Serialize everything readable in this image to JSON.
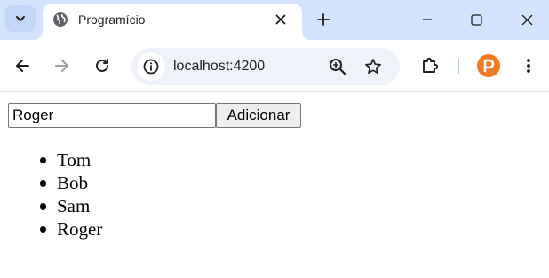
{
  "browser": {
    "tab": {
      "title": "Programício"
    },
    "address_bar": {
      "url": "localhost:4200"
    },
    "profile_initial": "P",
    "colors": {
      "tabstrip": "#d3e3fd",
      "profile": "#f27b21"
    }
  },
  "page": {
    "input": {
      "value": "Roger"
    },
    "add_button_label": "Adicionar",
    "names": [
      "Tom",
      "Bob",
      "Sam",
      "Roger"
    ]
  }
}
